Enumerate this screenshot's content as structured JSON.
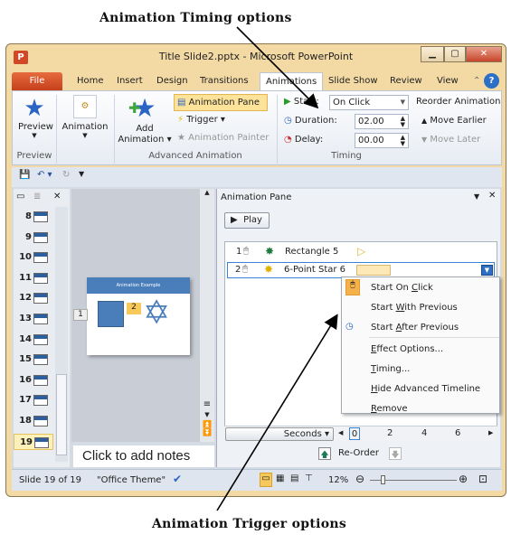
{
  "annotations": {
    "top": "Animation Timing options",
    "bottom": "Animation Trigger options"
  },
  "window": {
    "title": "Title Slide2.pptx  -  Microsoft PowerPoint",
    "logo": "P",
    "controls": [
      "minimize",
      "maximize",
      "close"
    ]
  },
  "tabs": [
    "File",
    "Home",
    "Insert",
    "Design",
    "Transitions",
    "Animations",
    "Slide Show",
    "Review",
    "View"
  ],
  "active_tab": "Animations",
  "ribbon": {
    "preview": {
      "label": "Preview",
      "group": "Preview"
    },
    "animation": {
      "label": "Animation"
    },
    "add_animation": {
      "line1": "Add",
      "line2": "Animation"
    },
    "animation_pane": "Animation Pane",
    "trigger": "Trigger",
    "animation_painter": "Animation Painter",
    "advanced_group": "Advanced Animation",
    "start_label": "Start:",
    "start_value": "On Click",
    "duration_label": "Duration:",
    "duration_value": "02.00",
    "delay_label": "Delay:",
    "delay_value": "00.00",
    "timing_group": "Timing",
    "reorder_title": "Reorder Animation",
    "move_earlier": "Move Earlier",
    "move_later": "Move Later"
  },
  "slides": [
    "8",
    "9",
    "10",
    "11",
    "12",
    "13",
    "14",
    "15",
    "16",
    "17",
    "18",
    "19"
  ],
  "current_slide": "19",
  "slide_preview": {
    "title": "Animation Example",
    "tag1": "1",
    "tag2": "2"
  },
  "notes_placeholder": "Click to add notes",
  "pane": {
    "title": "Animation Pane",
    "play": "Play",
    "items": [
      {
        "num": "1",
        "name": "Rectangle 5"
      },
      {
        "num": "2",
        "name": "6-Point Star 6"
      }
    ],
    "menu": [
      {
        "pre": "Start On ",
        "key": "C",
        "post": "lick"
      },
      {
        "pre": "Start ",
        "key": "W",
        "post": "ith Previous"
      },
      {
        "pre": "Start ",
        "key": "A",
        "post": "fter Previous"
      },
      {
        "pre": "",
        "key": "E",
        "post": "ffect Options..."
      },
      {
        "pre": "",
        "key": "T",
        "post": "iming..."
      },
      {
        "pre": "",
        "key": "H",
        "post": "ide Advanced Timeline"
      },
      {
        "pre": "",
        "key": "R",
        "post": "emove"
      }
    ],
    "seconds": "Seconds",
    "ticks": [
      "0",
      "2",
      "4",
      "6"
    ],
    "reorder": "Re-Order"
  },
  "status": {
    "slide": "Slide 19 of 19",
    "theme": "\"Office Theme\"",
    "zoom": "12%"
  },
  "colors": {
    "accent": "#f6c95a",
    "file_tab": "#d24726",
    "slide_blue": "#4a7ebb"
  }
}
